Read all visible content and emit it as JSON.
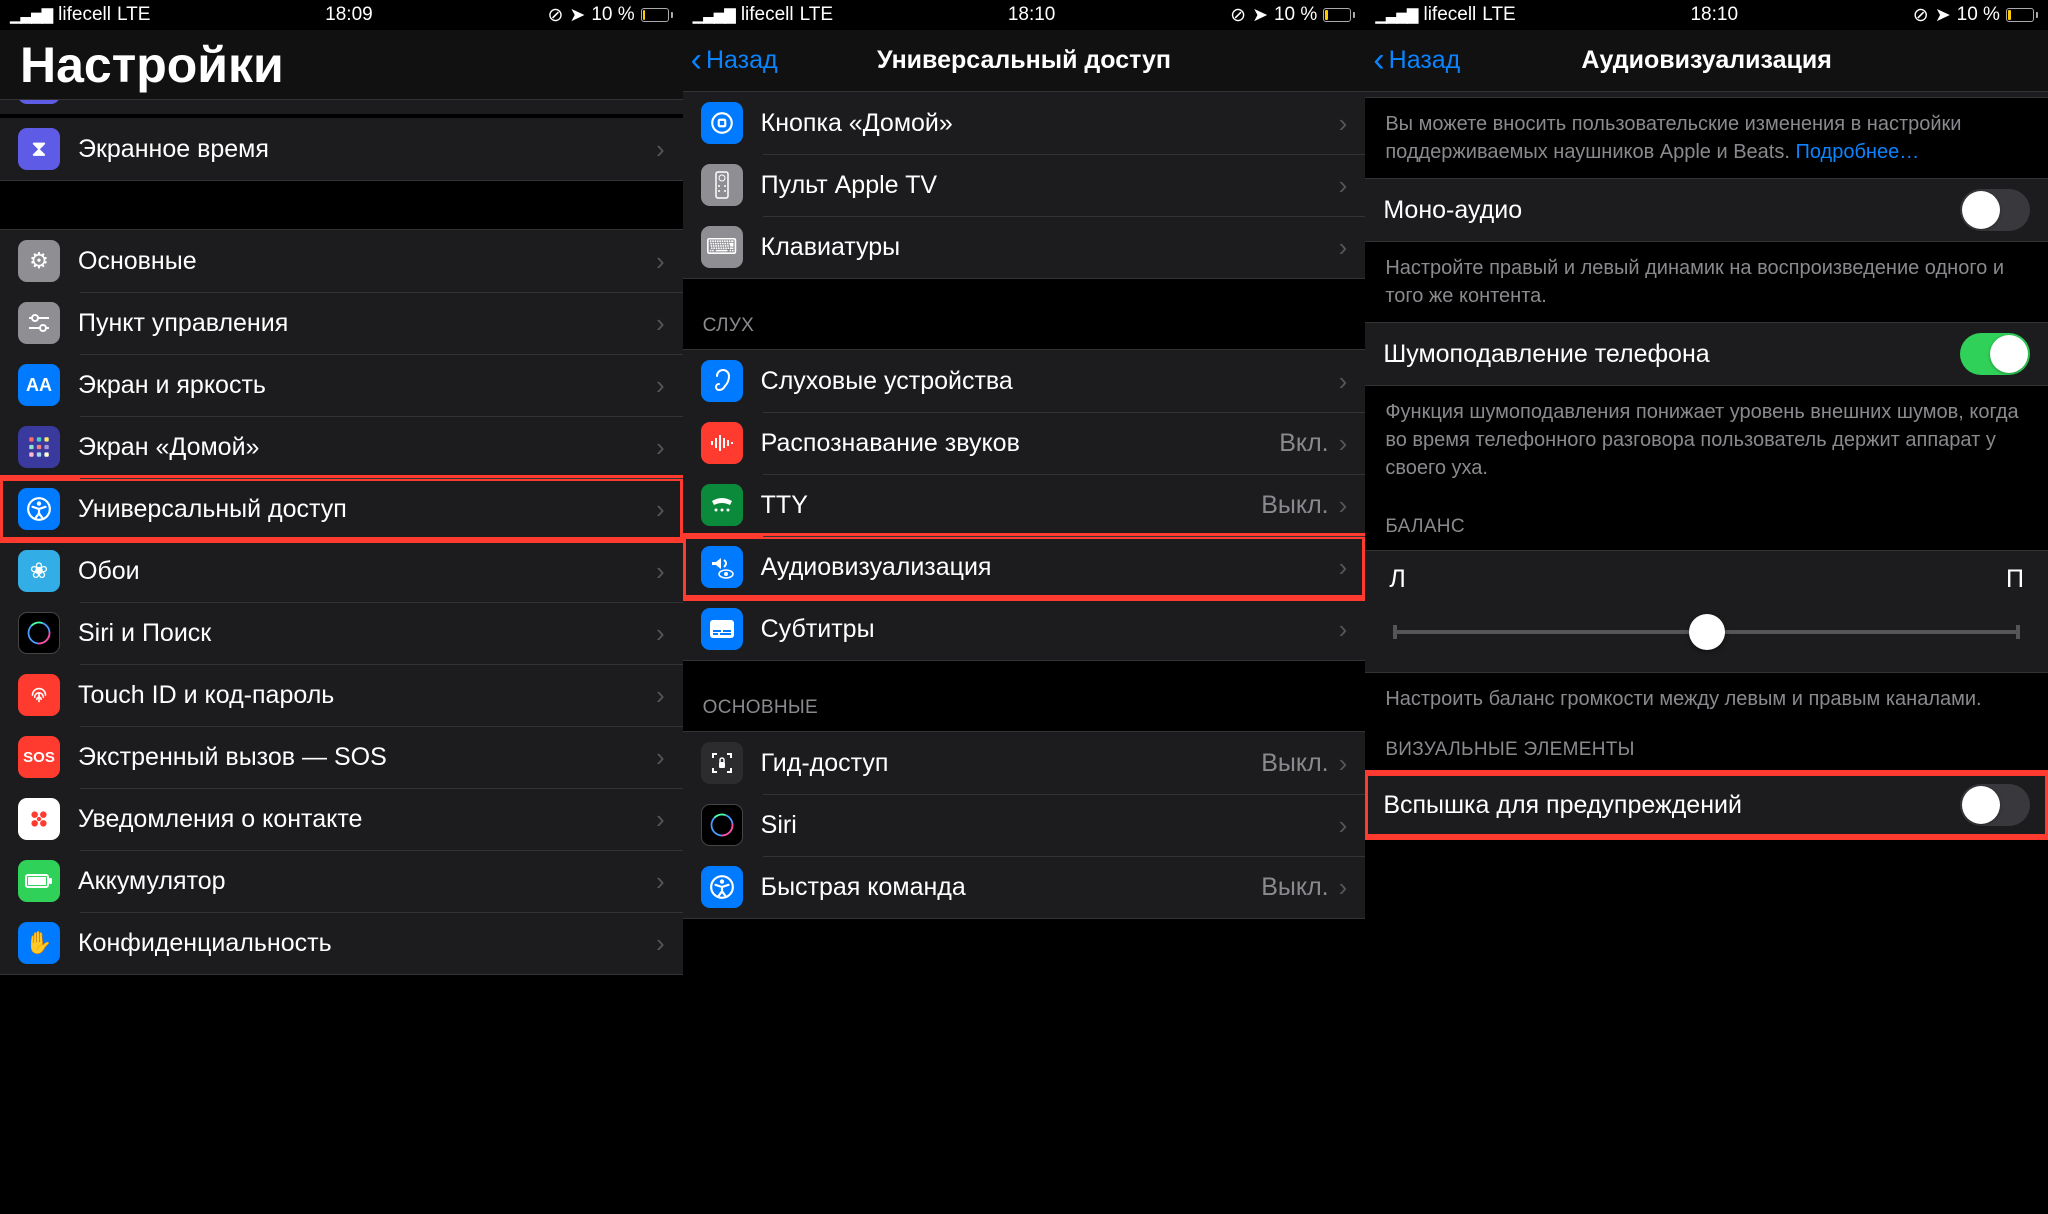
{
  "status": {
    "carrier": "lifecell",
    "net": "LTE",
    "time1": "18:09",
    "time2": "18:10",
    "time3": "18:10",
    "battery": "10 %"
  },
  "screen1": {
    "title": "Настройки",
    "items": [
      {
        "label": "Экранное время"
      },
      {
        "label": "Основные"
      },
      {
        "label": "Пункт управления"
      },
      {
        "label": "Экран и яркость"
      },
      {
        "label": "Экран «Домой»"
      },
      {
        "label": "Универсальный доступ"
      },
      {
        "label": "Обои"
      },
      {
        "label": "Siri и Поиск"
      },
      {
        "label": "Touch ID и код-пароль"
      },
      {
        "label": "Экстренный вызов — SOS"
      },
      {
        "label": "Уведомления о контакте"
      },
      {
        "label": "Аккумулятор"
      },
      {
        "label": "Конфиденциальность"
      }
    ]
  },
  "screen2": {
    "back": "Назад",
    "title": "Универсальный доступ",
    "items_top": [
      {
        "label": "Кнопка «Домой»"
      },
      {
        "label": "Пульт Apple TV"
      },
      {
        "label": "Клавиатуры"
      }
    ],
    "section_hearing": "СЛУХ",
    "items_hearing": [
      {
        "label": "Слуховые устройства",
        "value": ""
      },
      {
        "label": "Распознавание звуков",
        "value": "Вкл."
      },
      {
        "label": "TTY",
        "value": "Выкл."
      },
      {
        "label": "Аудиовизуализация",
        "value": ""
      },
      {
        "label": "Субтитры",
        "value": ""
      }
    ],
    "section_general": "ОСНОВНЫЕ",
    "items_general": [
      {
        "label": "Гид-доступ",
        "value": "Выкл."
      },
      {
        "label": "Siri",
        "value": ""
      },
      {
        "label": "Быстрая команда",
        "value": "Выкл."
      }
    ]
  },
  "screen3": {
    "back": "Назад",
    "title": "Аудиовизуализация",
    "desc1_a": "Вы можете вносить пользовательские изменения в настройки поддерживаемых наушников Apple и Beats. ",
    "desc1_link": "Подробнее…",
    "mono": "Моно-аудио",
    "desc2": "Настройте правый и левый динамик на воспроизведение одного и того же контента.",
    "noise": "Шумоподавление телефона",
    "desc3": "Функция шумоподавления понижает уровень внешних шумов, когда во время телефонного разговора пользователь держит аппарат у своего уха.",
    "balance_header": "БАЛАНС",
    "balance_left": "Л",
    "balance_right": "П",
    "desc4": "Настроить баланс громкости между левым и правым каналами.",
    "visual_header": "ВИЗУАЛЬНЫЕ ЭЛЕМЕНТЫ",
    "flash": "Вспышка для предупреждений"
  }
}
